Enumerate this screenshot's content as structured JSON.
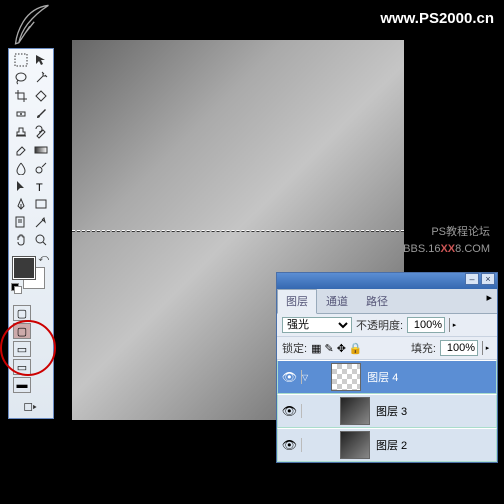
{
  "url": "www.PS2000.cn",
  "watermark": {
    "line1": "PS教程论坛",
    "line2_prefix": "BBS.16",
    "line2_red": "XX",
    "line2_suffix": "8.COM"
  },
  "panel": {
    "tabs": [
      "图层",
      "通道",
      "路径"
    ],
    "blend_mode": "强光",
    "opacity_label": "不透明度:",
    "opacity_value": "100%",
    "lock_label": "锁定:",
    "fill_label": "填充:",
    "fill_value": "100%",
    "layers": [
      {
        "name": "图层 4",
        "indent": true,
        "thumb": "check",
        "active": true
      },
      {
        "name": "图层 3",
        "indent": true,
        "thumb": "grad",
        "active": false
      },
      {
        "name": "图层 2",
        "indent": true,
        "thumb": "grad",
        "active": false
      }
    ]
  }
}
